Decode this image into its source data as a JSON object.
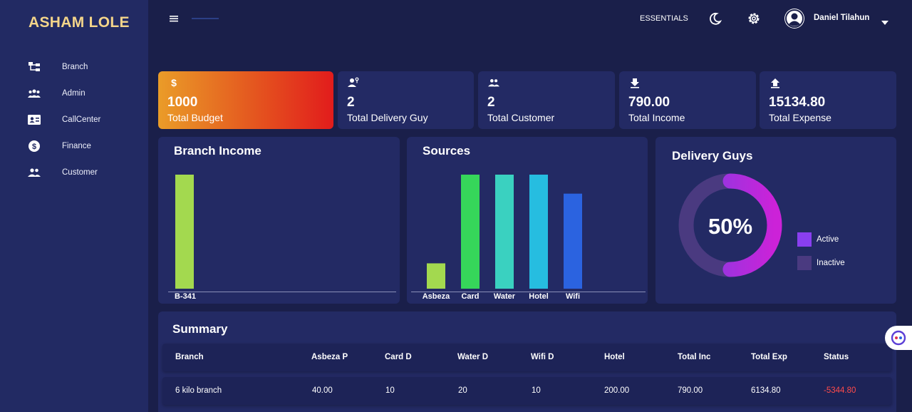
{
  "sidebar": {
    "brand": "ASHAM LOLE",
    "items": [
      {
        "label": "Branch",
        "icon": "sitemap-icon"
      },
      {
        "label": "Admin",
        "icon": "group-icon"
      },
      {
        "label": "CallCenter",
        "icon": "contact-card-icon"
      },
      {
        "label": "Finance",
        "icon": "dollar-circle-icon"
      },
      {
        "label": "Customer",
        "icon": "people-icon"
      }
    ]
  },
  "topbar": {
    "essentials": "ESSENTIALS",
    "user_name": "Daniel Tilahun",
    "icons": [
      "menu-icon",
      "moon-icon",
      "gear-icon",
      "user-avatar-icon",
      "caret-down-icon"
    ]
  },
  "cards": [
    {
      "value": "1000",
      "label": "Total Budget",
      "icon": "dollar-icon"
    },
    {
      "value": "2",
      "label": "Total Delivery Guy",
      "icon": "delivery-person-icon"
    },
    {
      "value": "2",
      "label": "Total Customer",
      "icon": "people-icon"
    },
    {
      "value": "790.00",
      "label": "Total Income",
      "icon": "download-icon"
    },
    {
      "value": "15134.80",
      "label": "Total Expense",
      "icon": "upload-icon"
    }
  ],
  "colors": {
    "background": "#1a1f4a",
    "panel": "#232a64",
    "sidebar": "#222a63",
    "brand": "#f4d58a",
    "negative": "#ff4b4b",
    "active": "#8a3ff0",
    "inactive": "#4a3a80"
  },
  "chart_data": [
    {
      "type": "bar",
      "title": "Branch Income",
      "categories": [
        "B-341"
      ],
      "values": [
        790
      ],
      "ylim": [
        0,
        790
      ],
      "colors": [
        "#a3d94f"
      ],
      "grid": false
    },
    {
      "type": "bar",
      "title": "Sources",
      "categories": [
        "Asbeza",
        "Card",
        "Water",
        "Hotel",
        "Wifi"
      ],
      "values": [
        40,
        180,
        180,
        180,
        150
      ],
      "ylim": [
        0,
        180
      ],
      "colors": [
        "#a3d94f",
        "#36d65a",
        "#3ad1c0",
        "#26bde0",
        "#2b63e0"
      ],
      "grid": false
    },
    {
      "type": "pie",
      "title": "Delivery Guys",
      "center_label": "50%",
      "categories": [
        "Active",
        "Inactive"
      ],
      "values": [
        50,
        50
      ],
      "colors": [
        "#8a3ff0",
        "#4a3a80"
      ],
      "legend": "right"
    }
  ],
  "summary": {
    "title": "Summary",
    "columns": [
      "Branch",
      "Asbeza P",
      "Card D",
      "Water D",
      "Wifi D",
      "Hotel",
      "Total Inc",
      "Total Exp",
      "Status"
    ],
    "rows": [
      [
        "6 kilo branch",
        "40.00",
        "10",
        "20",
        "10",
        "200.00",
        "790.00",
        "6134.80",
        "-5344.80"
      ]
    ]
  }
}
